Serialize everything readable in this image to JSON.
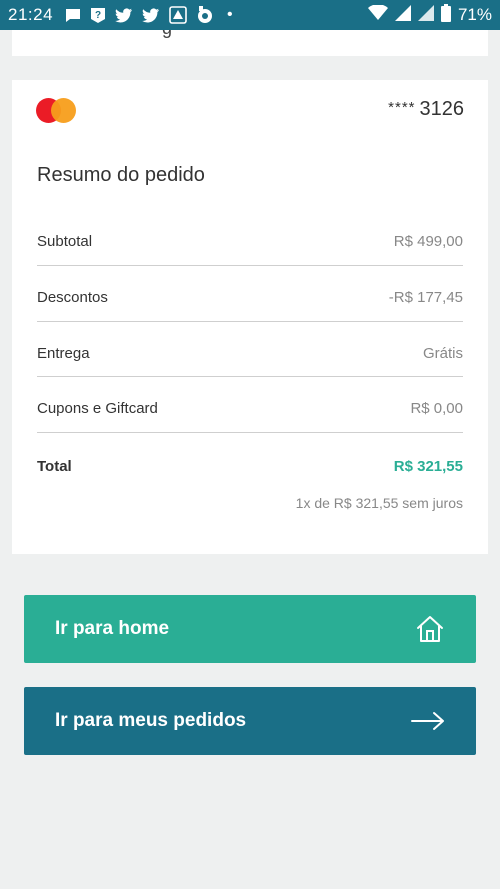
{
  "status_bar": {
    "time": "21:24",
    "battery": "71%",
    "dot": "•"
  },
  "top_stub": {
    "text": "g"
  },
  "payment": {
    "card_stars": "****",
    "card_last4": "3126"
  },
  "summary": {
    "title": "Resumo do pedido",
    "rows": [
      {
        "label": "Subtotal",
        "value": "R$ 499,00"
      },
      {
        "label": "Descontos",
        "value": "-R$ 177,45"
      },
      {
        "label": "Entrega",
        "value": "Grátis"
      },
      {
        "label": "Cupons e Giftcard",
        "value": "R$ 0,00"
      }
    ],
    "total_label": "Total",
    "total_value": "R$ 321,55",
    "installments": "1x de R$ 321,55 sem juros"
  },
  "buttons": {
    "home_label": "Ir para home",
    "orders_label": "Ir para meus pedidos"
  },
  "colors": {
    "primary_teal": "#2aae95",
    "primary_blue": "#1a6f87",
    "background": "#eef0f0"
  },
  "icons": {
    "home": "home-icon",
    "arrow": "arrow-right-icon"
  }
}
